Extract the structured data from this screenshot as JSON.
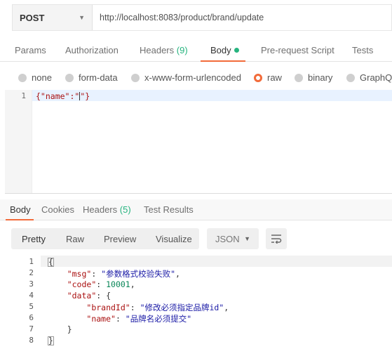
{
  "request": {
    "method": "POST",
    "url": "http://localhost:8083/product/brand/update"
  },
  "request_tabs": [
    {
      "label": "Params"
    },
    {
      "label": "Authorization"
    },
    {
      "label": "Headers",
      "count": "(9)"
    },
    {
      "label": "Body"
    },
    {
      "label": "Pre-request Script"
    },
    {
      "label": "Tests"
    }
  ],
  "body_types": [
    {
      "label": "none",
      "selected": false
    },
    {
      "label": "form-data",
      "selected": false
    },
    {
      "label": "x-www-form-urlencoded",
      "selected": false
    },
    {
      "label": "raw",
      "selected": true
    },
    {
      "label": "binary",
      "selected": false
    },
    {
      "label": "GraphQL",
      "selected": false
    }
  ],
  "request_body": {
    "line_number": "1",
    "prefix": "{\"name\":\"",
    "suffix": "\"}"
  },
  "response_tabs": [
    {
      "label": "Body"
    },
    {
      "label": "Cookies"
    },
    {
      "label": "Headers",
      "count": "(5)"
    },
    {
      "label": "Test Results"
    }
  ],
  "response_toolbar": {
    "views": [
      "Pretty",
      "Raw",
      "Preview",
      "Visualize"
    ],
    "format": "JSON"
  },
  "response_body": {
    "line_numbers": [
      "1",
      "2",
      "3",
      "4",
      "5",
      "6",
      "7",
      "8"
    ],
    "open_brace": "{",
    "close_brace": "}",
    "msg_key": "\"msg\"",
    "msg_value": "\"参数格式校验失败\"",
    "code_key": "\"code\"",
    "code_value": "10001",
    "data_key": "\"data\"",
    "data_open": "{",
    "brandId_key": "\"brandId\"",
    "brandId_value": "\"修改必须指定品牌id\"",
    "name_key": "\"name\"",
    "name_value": "\"品牌名必须提交\"",
    "data_close": "}"
  },
  "colors": {
    "accent": "#f26b3a",
    "success": "#26b47f"
  }
}
